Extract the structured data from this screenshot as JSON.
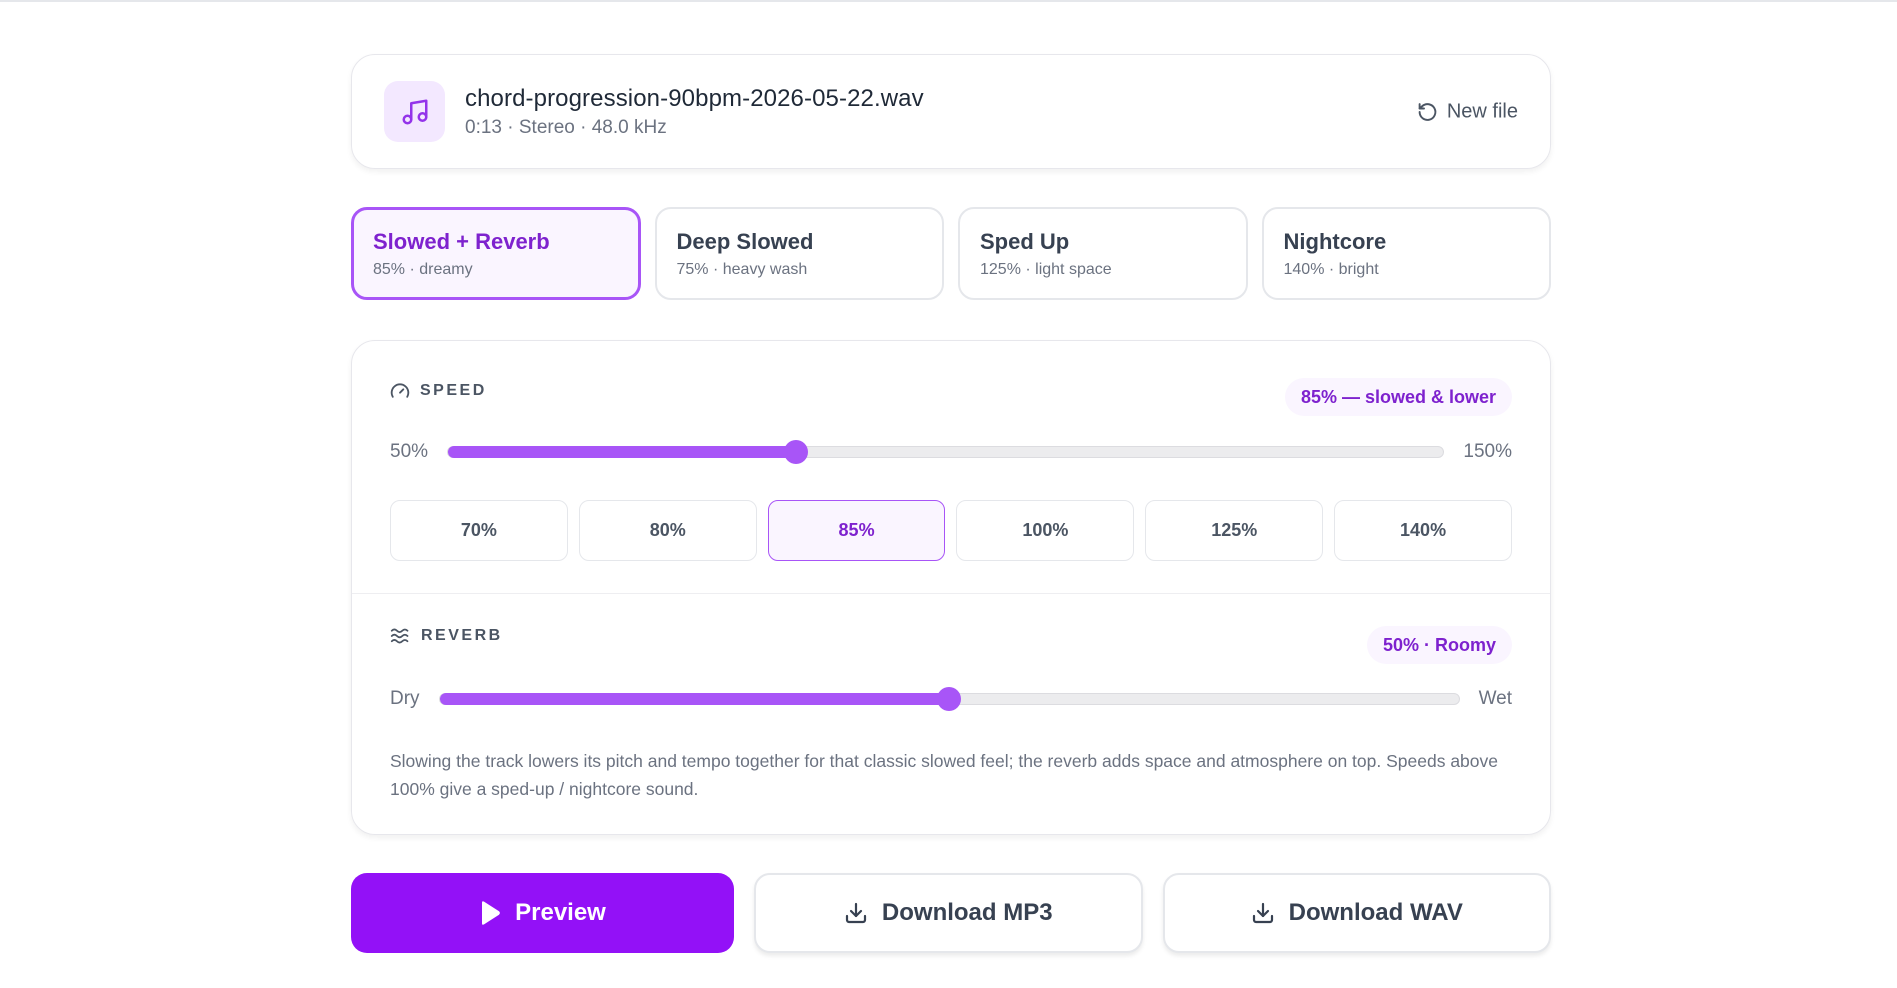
{
  "file": {
    "name": "chord-progression-90bpm-2026-05-22.wav",
    "info": "0:13 · Stereo · 48.0 kHz",
    "new_file_label": "New file",
    "icon": "music-note-icon"
  },
  "presets": [
    {
      "name": "Slowed + Reverb",
      "desc": "85% · dreamy",
      "active": true
    },
    {
      "name": "Deep Slowed",
      "desc": "75% · heavy wash",
      "active": false
    },
    {
      "name": "Sped Up",
      "desc": "125% · light space",
      "active": false
    },
    {
      "name": "Nightcore",
      "desc": "140% · bright",
      "active": false
    }
  ],
  "speed": {
    "title": "SPEED",
    "badge": "85% — slowed & lower",
    "min_label": "50%",
    "max_label": "150%",
    "min": 50,
    "max": 150,
    "value": 85,
    "options": [
      "70%",
      "80%",
      "85%",
      "100%",
      "125%",
      "140%"
    ],
    "selected": "85%"
  },
  "reverb": {
    "title": "REVERB",
    "badge": "50% · Roomy",
    "min_label": "Dry",
    "max_label": "Wet",
    "value_fraction": 0.5,
    "description": "Slowing the track lowers its pitch and tempo together for that classic slowed feel; the reverb adds space and atmosphere on top. Speeds above 100% give a sped-up / nightcore sound."
  },
  "actions": {
    "preview": "Preview",
    "download_mp3": "Download MP3",
    "download_wav": "Download WAV"
  },
  "colors": {
    "accent": "#a855f7",
    "accent_dark": "#7e22ce",
    "primary_button": "#9311f7"
  }
}
